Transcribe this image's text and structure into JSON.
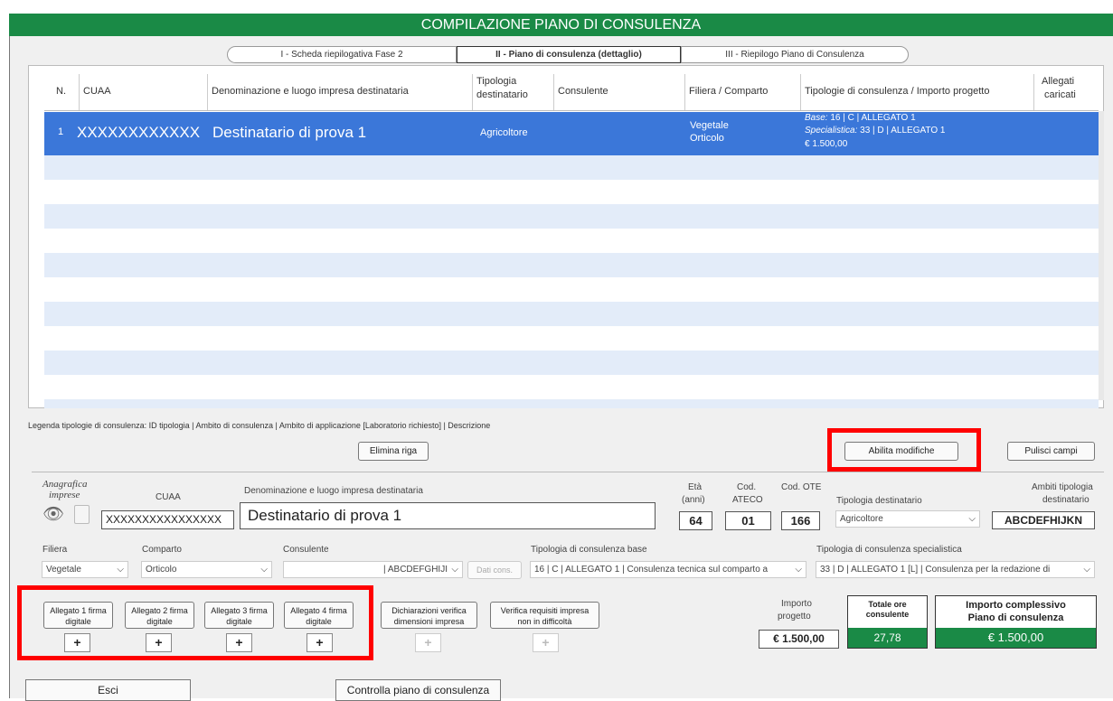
{
  "title": "COMPILAZIONE PIANO DI CONSULENZA",
  "tabs": [
    "I - Scheda riepilogativa Fase 2",
    "II - Piano di consulenza (dettaglio)",
    "III - Riepilogo Piano di Consulenza"
  ],
  "table": {
    "headers": {
      "n": "N.",
      "cuaa": "CUAA",
      "denominazione": "Denominazione e luogo impresa destinataria",
      "tipologia_1": "Tipologia",
      "tipologia_2": "destinatario",
      "consulente": "Consulente",
      "filiera": "Filiera / Comparto",
      "tipologie_consulenza": "Tipologie di consulenza / Importo progetto",
      "allegati_1": "Allegati",
      "allegati_2": "caricati"
    },
    "row": {
      "n": "1",
      "cuaa": "XXXXXXXXXXXX",
      "denominazione": "Destinatario di prova 1",
      "tipologia": "Agricoltore",
      "filiera": "Vegetale",
      "comparto": "Orticolo",
      "base_label": "Base:",
      "base_value": " 16 | C | ALLEGATO 1",
      "spec_label": "Specialistica:",
      "spec_value": " 33 | D | ALLEGATO 1",
      "importo": "€ 1.500,00"
    }
  },
  "legend": "Legenda tipologie di consulenza: ID tipologia | Ambito di consulenza | Ambito di applicazione [Laboratorio richiesto] | Descrizione",
  "buttons": {
    "elimina_riga": "Elimina riga",
    "abilita_modifiche": "Abilita modifiche",
    "pulisci_campi": "Pulisci campi",
    "dati_cons": "Dati cons.",
    "esci": "Esci",
    "controlla": "Controlla piano di consulenza",
    "plus": "+"
  },
  "form": {
    "anagrafica_1": "Anagrafica",
    "anagrafica_2": "imprese",
    "cuaa_label": "CUAA",
    "cuaa_value": "XXXXXXXXXXXXXXXX",
    "denom_label": "Denominazione e luogo impresa destinataria",
    "denom_value": "Destinatario di prova 1",
    "eta_label_1": "Età",
    "eta_label_2": "(anni)",
    "eta_value": "64",
    "ateco_label_1": "Cod.",
    "ateco_label_2": "ATECO",
    "ateco_value": "01",
    "ote_label": "Cod. OTE",
    "ote_value": "166",
    "tipologia_label": "Tipologia destinatario",
    "tipologia_value": "Agricoltore",
    "ambiti_label_1": "Ambiti tipologia",
    "ambiti_label_2": "destinatario",
    "ambiti_value": "ABCDEFHIJKN",
    "filiera_label": "Filiera",
    "filiera_value": "Vegetale",
    "comparto_label": "Comparto",
    "comparto_value": "Orticolo",
    "consulente_label": "Consulente",
    "consulente_value": "| ABCDEFGHIJI",
    "base_label": "Tipologia di consulenza base",
    "base_value": "16 | C | ALLEGATO 1 | Consulenza tecnica sul comparto a",
    "spec_label": "Tipologia di consulenza specialistica",
    "spec_value": "33 | D | ALLEGATO 1 [L] | Consulenza per la redazione di"
  },
  "allegati": [
    {
      "l1": "Allegato 1 firma",
      "l2": "digitale"
    },
    {
      "l1": "Allegato 2 firma",
      "l2": "digitale"
    },
    {
      "l1": "Allegato 3 firma",
      "l2": "digitale"
    },
    {
      "l1": "Allegato 4 firma",
      "l2": "digitale"
    }
  ],
  "dichiarazioni": {
    "l1": "Dichiarazioni verifica",
    "l2": "dimensioni impresa"
  },
  "verifica": {
    "l1": "Verifica requisiti impresa",
    "l2": "non in difficoltà"
  },
  "totali": {
    "importo_label_1": "Importo",
    "importo_label_2": "progetto",
    "importo_value": "€ 1.500,00",
    "ore_label_1": "Totale ore",
    "ore_label_2": "consulente",
    "ore_value": "27,78",
    "complessivo_label_1": "Importo complessivo",
    "complessivo_label_2": "Piano di consulenza",
    "complessivo_value": "€ 1.500,00"
  },
  "colors": {
    "header_green": "#1a8a46",
    "selection_blue": "#3b77d9",
    "alt_row": "#e3ecf9",
    "highlight_red": "#ff0000"
  }
}
